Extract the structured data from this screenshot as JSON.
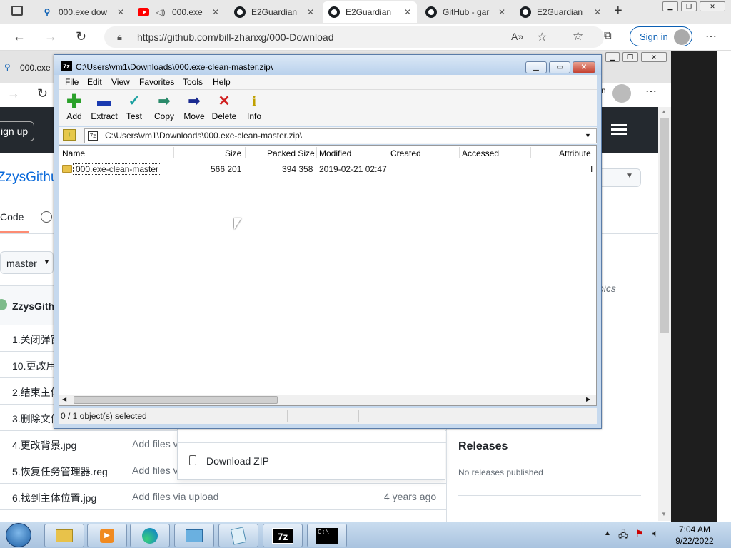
{
  "browser": {
    "tabs": [
      {
        "title": "000.exe dow",
        "icon": "search-icon"
      },
      {
        "title": "000.exe",
        "icon": "youtube-icon"
      },
      {
        "title": "E2Guardian",
        "icon": "github-icon"
      },
      {
        "title": "E2Guardian",
        "icon": "github-icon",
        "active": true
      },
      {
        "title": "GitHub - gar",
        "icon": "github-icon"
      },
      {
        "title": "E2Guardian",
        "icon": "github-icon"
      }
    ],
    "url": "https://github.com/bill-zhanxg/000-Download",
    "signin_label": "Sign in"
  },
  "bg_browser": {
    "tab_title": "000.exe",
    "signup_label": "ign up",
    "repo_name": "ZzysGithu",
    "code_tab": "Code",
    "branch": "master",
    "committer": "ZzysGithu",
    "topics_text": "pics",
    "releases_title": "Releases",
    "releases_empty": "No releases published",
    "download_zip": "Download ZIP",
    "files": [
      {
        "name": "1.关闭弹窗",
        "msg": "",
        "date": ""
      },
      {
        "name": "10.更改用",
        "msg": "",
        "date": ""
      },
      {
        "name": "2.结束主体",
        "msg": "",
        "date": ""
      },
      {
        "name": "3.删除文件",
        "msg": "",
        "date": ""
      },
      {
        "name": "4.更改背景.jpg",
        "msg": "Add files v",
        "date": ""
      },
      {
        "name": "5.恢复任务管理器.reg",
        "msg": "Add files v",
        "date": ""
      },
      {
        "name": "6.找到主体位置.jpg",
        "msg": "Add files via upload",
        "date": "4 years ago"
      }
    ]
  },
  "zip_window": {
    "title": "C:\\Users\\vm1\\Downloads\\000.exe-clean-master.zip\\",
    "menu": [
      "File",
      "Edit",
      "View",
      "Favorites",
      "Tools",
      "Help"
    ],
    "toolbar": [
      {
        "label": "Add",
        "icon": "add-icon",
        "glyph": "+",
        "color": "#2aa02a"
      },
      {
        "label": "Extract",
        "icon": "extract-icon",
        "glyph": "━",
        "color": "#1a3ab0"
      },
      {
        "label": "Test",
        "icon": "test-icon",
        "glyph": "✓",
        "color": "#1aa0a0"
      },
      {
        "label": "Copy",
        "icon": "copy-icon",
        "glyph": "➡",
        "color": "#2a8a6a"
      },
      {
        "label": "Move",
        "icon": "move-icon",
        "glyph": "➡",
        "color": "#1a2a90"
      },
      {
        "label": "Delete",
        "icon": "delete-icon",
        "glyph": "✕",
        "color": "#d02020"
      },
      {
        "label": "Info",
        "icon": "info-icon",
        "glyph": "i",
        "color": "#c0a000"
      }
    ],
    "path": "C:\\Users\\vm1\\Downloads\\000.exe-clean-master.zip\\",
    "columns": [
      "Name",
      "Size",
      "Packed Size",
      "Modified",
      "Created",
      "Accessed",
      "Attribute"
    ],
    "rows": [
      {
        "name": "000.exe-clean-master",
        "size": "566 201",
        "packed": "394 358",
        "modified": "2019-02-21 02:47",
        "created": "",
        "accessed": "",
        "attr": "I"
      }
    ],
    "status": "0 / 1 object(s) selected"
  },
  "taskbar": {
    "time": "7:04 AM",
    "date": "9/22/2022",
    "apps": [
      "explorer-icon",
      "media-player-icon",
      "edge-icon",
      "control-panel-icon",
      "notepad-icon",
      "7zip-icon",
      "cmd-icon"
    ]
  }
}
